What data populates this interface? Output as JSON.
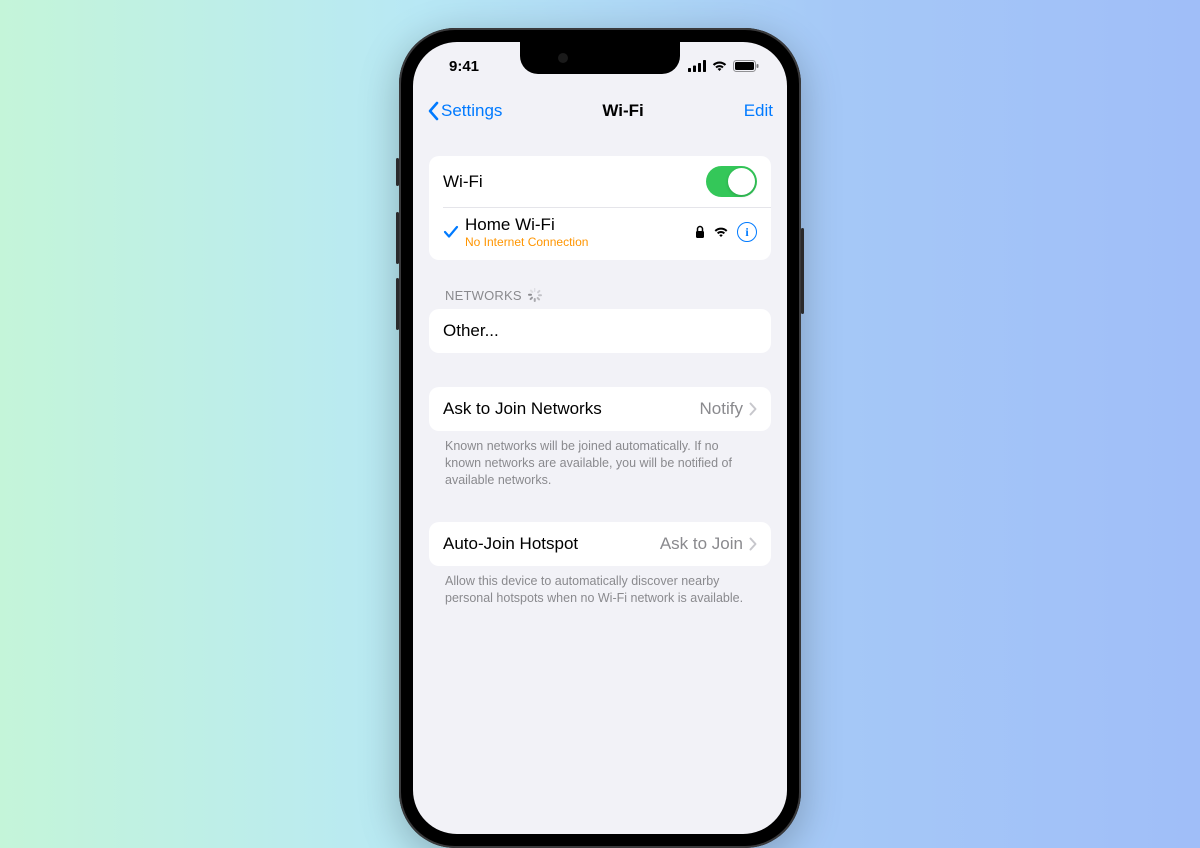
{
  "status": {
    "time": "9:41"
  },
  "nav": {
    "back": "Settings",
    "title": "Wi-Fi",
    "edit": "Edit"
  },
  "wifi": {
    "toggle_label": "Wi-Fi",
    "connected": {
      "name": "Home Wi-Fi",
      "subtitle": "No Internet Connection"
    }
  },
  "networks": {
    "header": "NETWORKS",
    "other": "Other..."
  },
  "ask_join": {
    "label": "Ask to Join Networks",
    "value": "Notify",
    "footer": "Known networks will be joined automatically. If no known networks are available, you will be notified of available networks."
  },
  "auto_hotspot": {
    "label": "Auto-Join Hotspot",
    "value": "Ask to Join",
    "footer": "Allow this device to automatically discover nearby personal hotspots when no Wi-Fi network is available."
  },
  "colors": {
    "accent": "#007aff",
    "toggle_on": "#34c759",
    "warning": "#ff9500"
  }
}
